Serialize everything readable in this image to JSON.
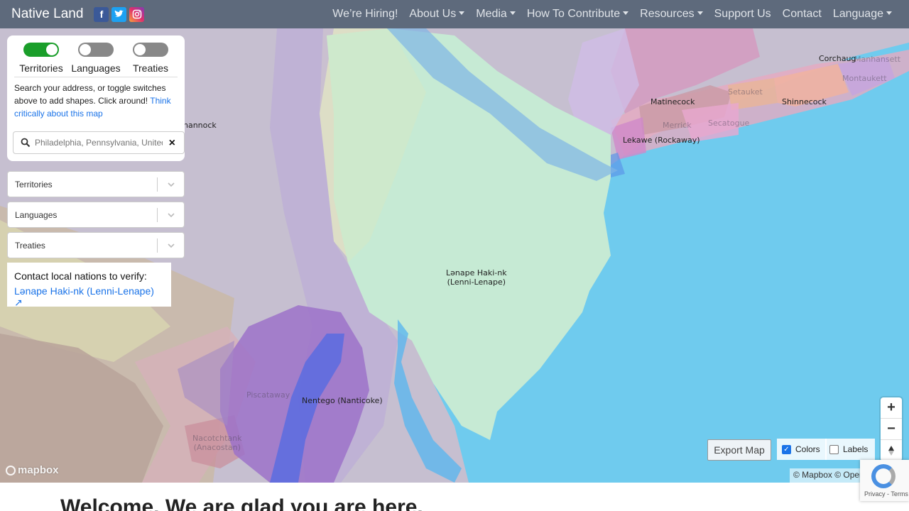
{
  "nav": {
    "brand": "Native Land",
    "social_icons": [
      "facebook-icon",
      "twitter-icon",
      "instagram-icon"
    ],
    "links": [
      {
        "label": "We’re Hiring!",
        "dropdown": false
      },
      {
        "label": "About Us",
        "dropdown": true
      },
      {
        "label": "Media",
        "dropdown": true
      },
      {
        "label": "How To Contribute",
        "dropdown": true
      },
      {
        "label": "Resources",
        "dropdown": true
      },
      {
        "label": "Support Us",
        "dropdown": false
      },
      {
        "label": "Contact",
        "dropdown": false
      },
      {
        "label": "Language",
        "dropdown": true
      }
    ]
  },
  "panel": {
    "toggles": [
      {
        "label": "Territories",
        "on": true
      },
      {
        "label": "Languages",
        "on": false
      },
      {
        "label": "Treaties",
        "on": false
      }
    ],
    "help_text": "Search your address, or toggle switches above to add shapes. Click around!",
    "help_link": "Think critically about this map",
    "search_placeholder": "Philadelphia, Pennsylvania, United States",
    "clear_symbol": "×"
  },
  "selects": [
    {
      "label": "Territories"
    },
    {
      "label": "Languages"
    },
    {
      "label": "Treaties"
    }
  ],
  "contact": {
    "title": "Contact local nations to verify:",
    "link": "Lənape Haki-nk (Lenni-Lenape) ↗"
  },
  "map": {
    "labels": {
      "lenape": "Lənape Haki-nk\n(Lenni-Lenape)",
      "nentego": "Nentego (Nanticoke)",
      "lekawe": "Lekawe (Rockaway)",
      "matinecock": "Matinecock",
      "shinnecock": "Shinnecock",
      "corchaug": "Corchaug",
      "nannock": "nannock",
      "setauket": "Setauket",
      "merrick": "Merrick",
      "secatogue": "Secatogue",
      "montaukett": "Montaukett",
      "manhansett": "Manhansett",
      "piscataway": "Piscataway",
      "nacotchtank": "Nacotchtank\n(Anacostan)"
    },
    "colors": {
      "water": "#6ecbef",
      "lenape": "#c8ead4",
      "nanticoke": "#9b6fc7",
      "lavender": "#c8b9d9"
    }
  },
  "controls": {
    "zoom_in": "+",
    "zoom_out": "−",
    "compass": "⇡",
    "export_label": "Export Map",
    "colors_label": "Colors",
    "colors_checked": true,
    "labels_label": "Labels",
    "labels_checked": false,
    "mapbox_logo": "mapbox",
    "attribution": "© Mapbox © OpenStreetMap",
    "recaptcha": "Privacy - Terms"
  },
  "welcome": "Welcome. We are glad you are here."
}
